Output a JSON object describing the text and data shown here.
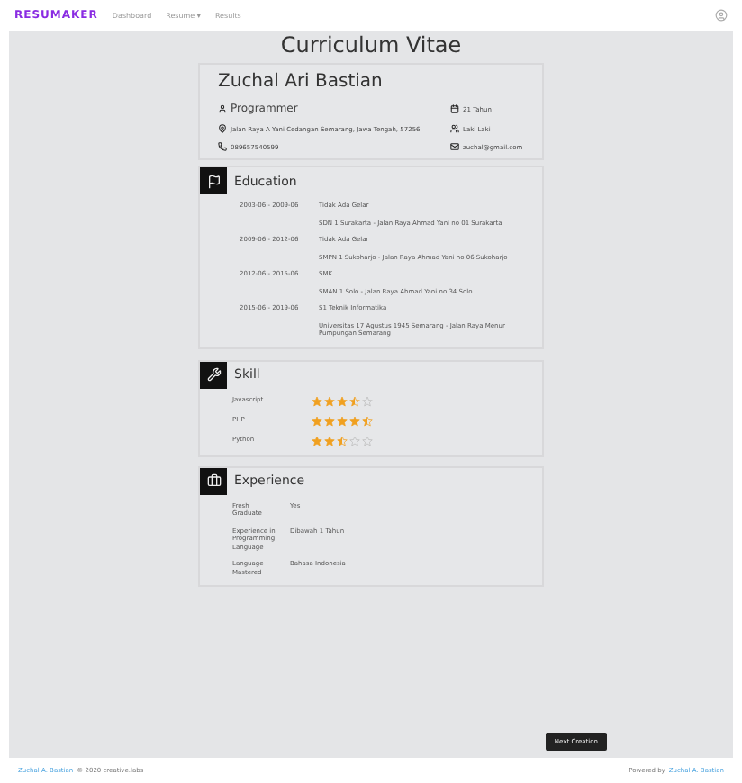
{
  "nav": {
    "brand": "RESUMAKER",
    "links": [
      {
        "label": "Dashboard",
        "selected": false
      },
      {
        "label": "Resume ▾",
        "selected": false
      },
      {
        "label": "Results",
        "selected": false
      }
    ]
  },
  "title": "Curriculum Vitae",
  "profile": {
    "name": "Zuchal Ari Bastian",
    "job": "Programmer",
    "age": "21 Tahun",
    "address": "Jalan Raya A Yani Cedangan Semarang, Jawa Tengah, 57256",
    "gender": "Laki Laki",
    "phone": "089657540599",
    "email": "zuchal@gmail.com"
  },
  "education": {
    "heading": "Education",
    "items": [
      {
        "period": "2003-06 - 2009-06",
        "degree": "Tidak Ada Gelar",
        "school": "SDN 1 Surakarta - Jalan Raya Ahmad Yani no 01 Surakarta"
      },
      {
        "period": "2009-06 - 2012-06",
        "degree": "Tidak Ada Gelar",
        "school": "SMPN 1 Sukoharjo - Jalan Raya Ahmad Yani no 06 Sukoharjo"
      },
      {
        "period": "2012-06 - 2015-06",
        "degree": "SMK",
        "school": "SMAN 1 Solo - Jalan Raya Ahmad Yani no 34 Solo"
      },
      {
        "period": "2015-06 - 2019-06",
        "degree": "S1 Teknik Informatika",
        "school": "Universitas 17 Agustus 1945 Semarang - Jalan Raya Menur Pumpungan Semarang"
      }
    ]
  },
  "skill": {
    "heading": "Skill",
    "items": [
      {
        "name": "Javascript",
        "stars": 3.5
      },
      {
        "name": "PHP",
        "stars": 4.5
      },
      {
        "name": "Python",
        "stars": 2.5
      }
    ]
  },
  "experience": {
    "heading": "Experience",
    "items": [
      {
        "label": "Fresh Graduate",
        "value": "Yes"
      },
      {
        "label": "Experience in Programming Language",
        "value": "Dibawah 1 Tahun"
      },
      {
        "label": "Language Mastered",
        "value": "Bahasa Indonesia"
      }
    ]
  },
  "next_button": "Next Creation",
  "footer": {
    "left_link": "Zuchal A. Bastian",
    "left_text": "© 2020 creative.labs",
    "right_text": "Powered by",
    "right_link": "Zuchal A. Bastian"
  }
}
